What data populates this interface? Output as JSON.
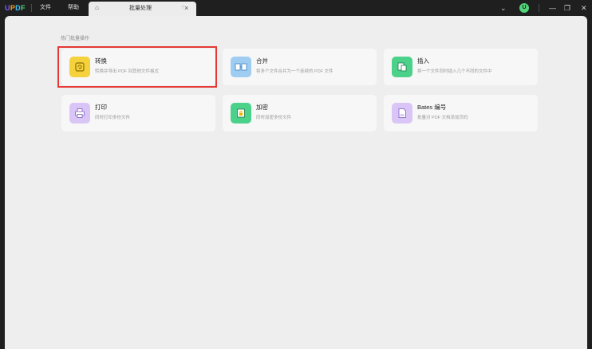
{
  "app": {
    "logo": {
      "u": "U",
      "p": "P",
      "d": "D",
      "f": "F"
    },
    "menu": {
      "file": "文件",
      "help": "帮助"
    }
  },
  "tab": {
    "home_icon": "⌂",
    "title": "批量处理",
    "close": "×",
    "add": "+"
  },
  "window_controls": {
    "chevron": "⌄",
    "avatar": "U",
    "minimize": "—",
    "restore": "❐",
    "close": "✕"
  },
  "section_title": "热门批量操作",
  "cards": [
    {
      "title": "转换",
      "desc": "转换并导出 PDF 到其他文件格式",
      "icon": "convert-icon",
      "color": "#f5d23d"
    },
    {
      "title": "合并",
      "desc": "将多个文件合并为一个连续的 PDF 文件",
      "icon": "merge-icon",
      "color": "#9fcdf2"
    },
    {
      "title": "插入",
      "desc": "将一个文件同时插入几个不同的文件中",
      "icon": "insert-icon",
      "color": "#4cd18a"
    },
    {
      "title": "打印",
      "desc": "同时打印多份文件",
      "icon": "print-icon",
      "color": "#d9c6f7"
    },
    {
      "title": "加密",
      "desc": "同时加密多份文件",
      "icon": "lock-icon",
      "color": "#4cd18a"
    },
    {
      "title": "Bates 编号",
      "desc": "批量对 PDF 文档添加页码",
      "icon": "bates-icon",
      "color": "#d9c6f7"
    }
  ],
  "colors": {
    "highlight": "#e53935",
    "titlebar": "#1f1f1f",
    "content_bg": "#eeeeee"
  }
}
